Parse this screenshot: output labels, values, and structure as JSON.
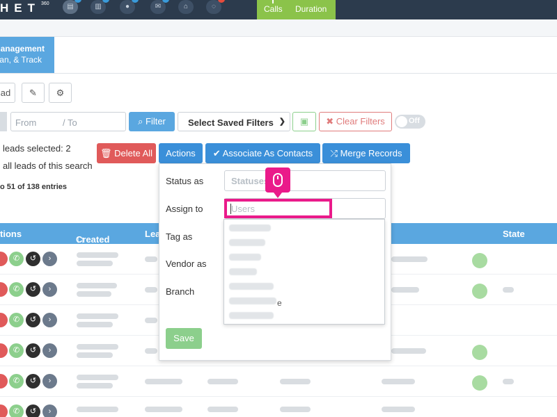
{
  "topbar": {
    "logo": "HET",
    "logo_sup": "360",
    "calls_label": "Calls",
    "duration_label": "Duration"
  },
  "management_tab": {
    "line1": "Management",
    "line2": "an, & Track"
  },
  "toolbar": {
    "partial_label": "ad"
  },
  "filters": {
    "from_placeholder": "From",
    "to_placeholder": "/ To",
    "filter_label": "Filter",
    "saved_filters_label": "Select Saved Filters",
    "clear_filters_label": "Clear Filters",
    "toggle_label": "Off"
  },
  "selection": {
    "leads_selected": "leads selected: 2",
    "all_leads": "all leads of this search",
    "entries": "o 51 of 138 entries"
  },
  "bulk_actions": {
    "delete_all": "Delete All",
    "actions": "Actions",
    "associate_contacts": "Associate As Contacts",
    "merge_records": "Merge Records"
  },
  "actions_panel": {
    "status_label": "Status as",
    "status_placeholder": "Statuses",
    "assign_label": "Assign to",
    "assign_placeholder": "Users",
    "tag_label": "Tag as",
    "vendor_label": "Vendor as",
    "branch_label": "Branch",
    "save_label": "Save",
    "dropdown_visible_fragment": "e"
  },
  "table": {
    "col_actions": "tions",
    "col_created": "Created",
    "col_lead": "Lea",
    "col_state": "State"
  },
  "colors": {
    "topbar": "#2c3b4d",
    "accent_blue": "#3a8fd9",
    "header_blue": "#5aa7e0",
    "danger": "#e05a5a",
    "success": "#8ccf8c",
    "highlight_pink": "#ea1a8a"
  }
}
